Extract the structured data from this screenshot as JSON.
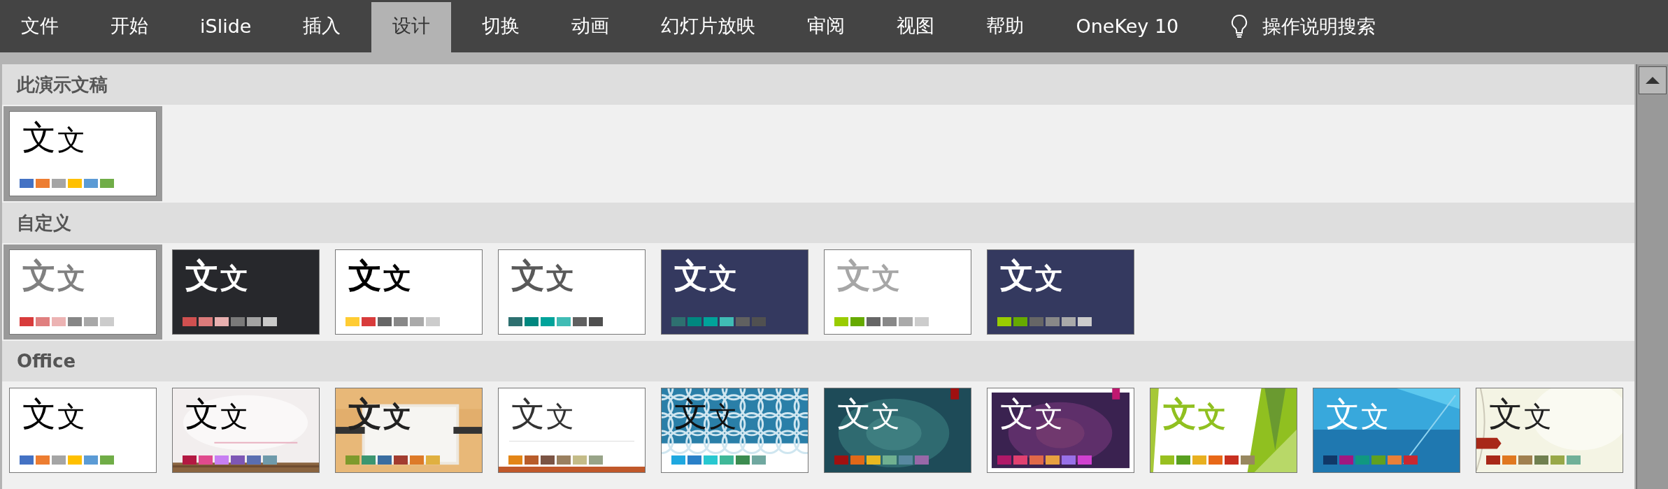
{
  "tabs": [
    {
      "label": "文件",
      "selected": false
    },
    {
      "label": "开始",
      "selected": false
    },
    {
      "label": "iSlide",
      "selected": false
    },
    {
      "label": "插入",
      "selected": false
    },
    {
      "label": "设计",
      "selected": true
    },
    {
      "label": "切换",
      "selected": false
    },
    {
      "label": "动画",
      "selected": false
    },
    {
      "label": "幻灯片放映",
      "selected": false
    },
    {
      "label": "审阅",
      "selected": false
    },
    {
      "label": "视图",
      "selected": false
    },
    {
      "label": "帮助",
      "selected": false
    },
    {
      "label": "OneKey 10",
      "selected": false
    }
  ],
  "tell_me": {
    "label": "操作说明搜索"
  },
  "sections": [
    {
      "title": "此演示文稿",
      "themes": [
        {
          "selected": true,
          "kind": "plain",
          "heading": "文",
          "body": "文",
          "swatches": [
            {
              "color": "#4472c4"
            },
            {
              "color": "#ed7d31"
            },
            {
              "color": "#a5a5a5"
            },
            {
              "color": "#ffc000"
            },
            {
              "color": "#5b9bd5"
            },
            {
              "color": "#70ad47"
            }
          ]
        }
      ]
    },
    {
      "title": "自定义",
      "themes": [
        {
          "selected": true,
          "kind": "gray",
          "heading": "文",
          "body": "文",
          "swatches": [
            {
              "color": "#d83b3b"
            },
            {
              "color": "#e07f7f"
            },
            {
              "color": "#ecb3b3"
            },
            {
              "color": "#868686"
            },
            {
              "color": "#a8a8a8"
            },
            {
              "color": "#cccccc"
            }
          ]
        },
        {
          "selected": false,
          "kind": "dark",
          "heading": "文",
          "body": "文",
          "swatches": [
            {
              "color": "#d05050"
            },
            {
              "color": "#dc7b7b"
            },
            {
              "color": "#e8b0b0"
            },
            {
              "color": "#7a7a7a"
            },
            {
              "color": "#a3a3a3"
            },
            {
              "color": "#c9c9c9"
            }
          ]
        },
        {
          "selected": false,
          "kind": "black",
          "heading": "文",
          "body": "文",
          "swatches": [
            {
              "color": "#ffcc33"
            },
            {
              "color": "#d83b3b"
            },
            {
              "color": "#666666"
            },
            {
              "color": "#888888"
            },
            {
              "color": "#aaaaaa"
            },
            {
              "color": "#cccccc"
            }
          ]
        },
        {
          "selected": false,
          "kind": "charcoal",
          "heading": "文",
          "body": "文",
          "swatches": [
            {
              "color": "#2e7070"
            },
            {
              "color": "#00877f"
            },
            {
              "color": "#00a39a"
            },
            {
              "color": "#40bcb5"
            },
            {
              "color": "#606060"
            },
            {
              "color": "#505050"
            }
          ]
        },
        {
          "selected": false,
          "kind": "navy",
          "heading": "文",
          "body": "文",
          "swatches": [
            {
              "color": "#2e7070"
            },
            {
              "color": "#00877f"
            },
            {
              "color": "#00a39a"
            },
            {
              "color": "#40bcb5"
            },
            {
              "color": "#606060"
            },
            {
              "color": "#505050"
            }
          ]
        },
        {
          "selected": false,
          "kind": "silver",
          "heading": "文",
          "body": "文",
          "swatches": [
            {
              "color": "#99cc00"
            },
            {
              "color": "#66aa00"
            },
            {
              "color": "#666666"
            },
            {
              "color": "#888888"
            },
            {
              "color": "#aaaaaa"
            },
            {
              "color": "#cccccc"
            }
          ]
        },
        {
          "selected": false,
          "kind": "navy",
          "heading": "文",
          "body": "文",
          "swatches": [
            {
              "color": "#99cc00"
            },
            {
              "color": "#66aa00"
            },
            {
              "color": "#666666"
            },
            {
              "color": "#888888"
            },
            {
              "color": "#aaaaaa"
            },
            {
              "color": "#cccccc"
            }
          ]
        }
      ]
    },
    {
      "title": "Office",
      "themes": [
        {
          "selected": false,
          "kind": "plain",
          "heading": "文",
          "body": "文",
          "swatches": [
            {
              "color": "#4472c4"
            },
            {
              "color": "#ed7d31"
            },
            {
              "color": "#a5a5a5"
            },
            {
              "color": "#ffc000"
            },
            {
              "color": "#5b9bd5"
            },
            {
              "color": "#70ad47"
            }
          ]
        },
        {
          "selected": false,
          "kind": "paper-floor",
          "heading": "文",
          "body": "文",
          "swatches": [
            {
              "color": "#b31942"
            },
            {
              "color": "#e04a8d"
            },
            {
              "color": "#c77ff2"
            },
            {
              "color": "#7e57b5"
            },
            {
              "color": "#5a6eb0"
            },
            {
              "color": "#6f9aaa"
            }
          ]
        },
        {
          "selected": false,
          "kind": "wood-card",
          "heading": "文",
          "body": "文",
          "swatches": [
            {
              "color": "#7e9a2c"
            },
            {
              "color": "#3c9670"
            },
            {
              "color": "#3a6da0"
            },
            {
              "color": "#a23c30"
            },
            {
              "color": "#dd7a28"
            },
            {
              "color": "#e0b040"
            }
          ]
        },
        {
          "selected": false,
          "kind": "stripe-bottom",
          "heading": "文",
          "body": "文",
          "swatches": [
            {
              "color": "#e38516"
            },
            {
              "color": "#b85c2a"
            },
            {
              "color": "#7b5444"
            },
            {
              "color": "#9a8060"
            },
            {
              "color": "#c4bc88"
            },
            {
              "color": "#98a488"
            }
          ]
        },
        {
          "selected": false,
          "kind": "rings",
          "heading": "文",
          "body": "文",
          "swatches": [
            {
              "color": "#1fa8e0"
            },
            {
              "color": "#2a80c8"
            },
            {
              "color": "#28c8d0"
            },
            {
              "color": "#40b898"
            },
            {
              "color": "#3c8c50"
            },
            {
              "color": "#70a8a0"
            }
          ]
        },
        {
          "selected": false,
          "kind": "teal-glow",
          "heading": "文",
          "body": "文",
          "swatches": [
            {
              "color": "#a01010"
            },
            {
              "color": "#e06818"
            },
            {
              "color": "#e8b820"
            },
            {
              "color": "#70b090"
            },
            {
              "color": "#5888a0"
            },
            {
              "color": "#9868a8"
            }
          ]
        },
        {
          "selected": false,
          "kind": "purple-glow",
          "heading": "文",
          "body": "文",
          "swatches": [
            {
              "color": "#b01868"
            },
            {
              "color": "#e04070"
            },
            {
              "color": "#e06848"
            },
            {
              "color": "#e8a040"
            },
            {
              "color": "#9870e8"
            },
            {
              "color": "#d040d0"
            }
          ]
        },
        {
          "selected": false,
          "kind": "green-facets",
          "heading": "文",
          "body": "文",
          "swatches": [
            {
              "color": "#98c020"
            },
            {
              "color": "#58a020"
            },
            {
              "color": "#e8b020"
            },
            {
              "color": "#e86818"
            },
            {
              "color": "#c83020"
            },
            {
              "color": "#988860"
            }
          ]
        },
        {
          "selected": false,
          "kind": "blue-light",
          "heading": "文",
          "body": "文",
          "swatches": [
            {
              "color": "#103868"
            },
            {
              "color": "#a01880"
            },
            {
              "color": "#109880"
            },
            {
              "color": "#60a020"
            },
            {
              "color": "#e88038"
            },
            {
              "color": "#c82830"
            }
          ]
        },
        {
          "selected": false,
          "kind": "cream-flag",
          "heading": "文",
          "body": "文",
          "swatches": [
            {
              "color": "#a82818"
            },
            {
              "color": "#e07820"
            },
            {
              "color": "#a08050"
            },
            {
              "color": "#708050"
            },
            {
              "color": "#98a848"
            },
            {
              "color": "#70b098"
            }
          ]
        }
      ]
    }
  ]
}
